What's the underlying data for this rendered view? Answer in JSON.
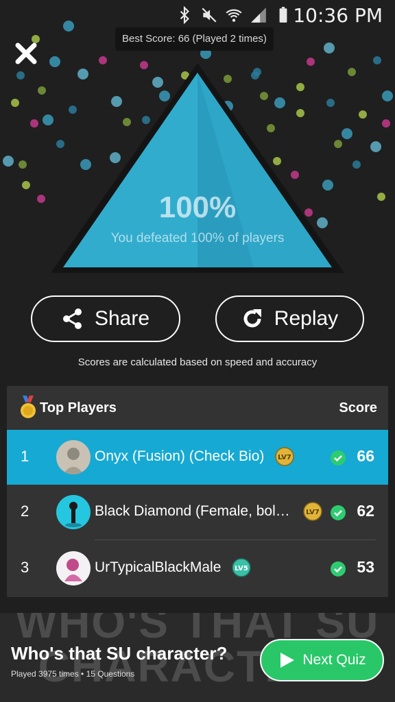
{
  "status_bar": {
    "time": "10:36 PM",
    "icons": [
      "bluetooth-icon",
      "mute-icon",
      "wifi-icon",
      "signal-icon",
      "battery-icon"
    ]
  },
  "best_score": "Best Score: 66 (Played 2 times)",
  "result": {
    "percent": "100%",
    "message": "You defeated 100% of players"
  },
  "actions": {
    "share_label": "Share",
    "replay_label": "Replay"
  },
  "score_note": "Scores are calculated based on speed and accuracy",
  "leaderboard": {
    "title": "Top Players",
    "score_header": "Score",
    "rows": [
      {
        "rank": "1",
        "name": "Onyx (Fusion) (Check Bio)",
        "level": "LV7",
        "score": "66",
        "highlight": true
      },
      {
        "rank": "2",
        "name": "Black Diamond (Female, bol…",
        "level": "LV7",
        "score": "62",
        "highlight": false
      },
      {
        "rank": "3",
        "name": "UrTypicalBlackMale",
        "level": "LV5",
        "score": "53",
        "highlight": false
      }
    ]
  },
  "banner": {
    "bg_text": "WHO'S THAT SU CHARACTER?",
    "title": "Who's that SU character?",
    "meta": "Played 3975 times  •  15 Questions",
    "next_label": "Next Quiz"
  },
  "colors": {
    "accent": "#16a9d3",
    "next_button": "#29c768",
    "pyramid": "#2ea6c8",
    "check": "#2ecc71",
    "level_badge": "#e0b43a"
  }
}
